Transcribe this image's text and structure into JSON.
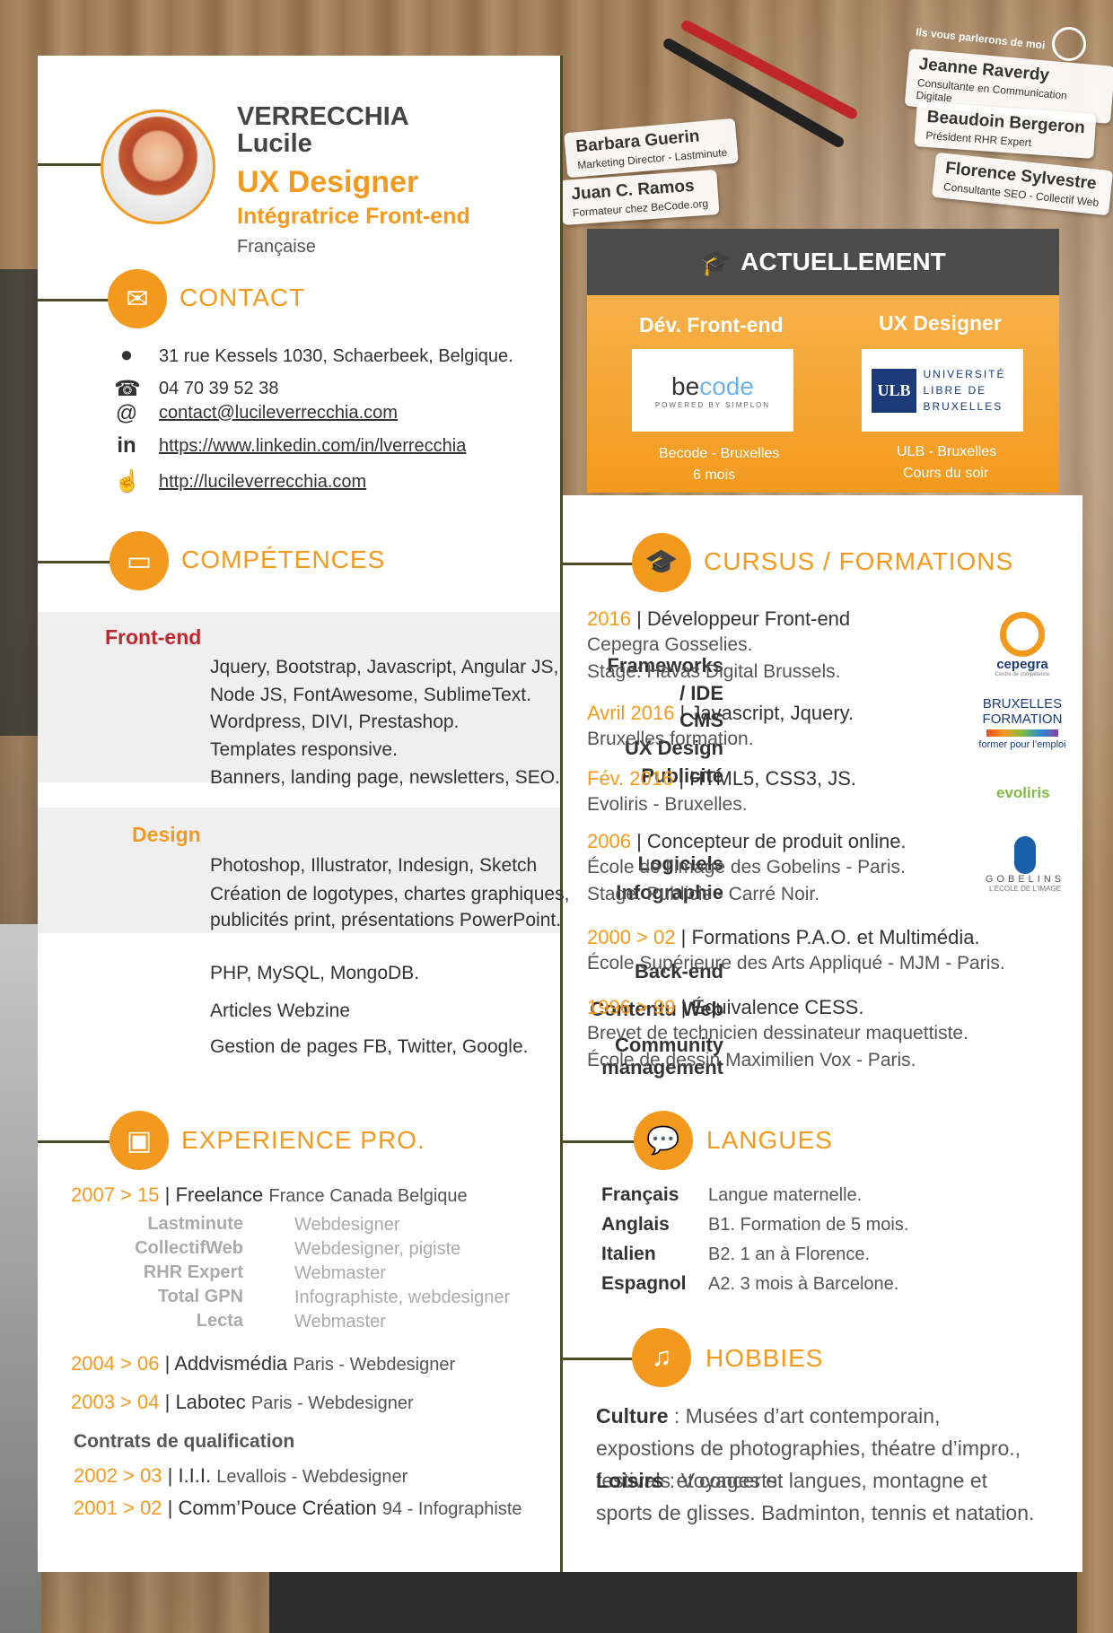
{
  "header": {
    "last_name": "VERRECCHIA",
    "first_name": "Lucile",
    "title": "UX Designer",
    "subtitle": "Intégratrice Front-end",
    "nationality": "Française"
  },
  "contact": {
    "title": "CONTACT",
    "address": "31 rue Kessels 1030, Schaerbeek, Belgique.",
    "phone": "04 70 39 52 38",
    "email": "contact@lucileverrecchia.com",
    "linkedin": "https://www.linkedin.com/in/lverrecchia",
    "website": "http://lucileverrecchia.com"
  },
  "skills": {
    "title": "COMPÉTENCES",
    "frontend": {
      "heading": "Front-end",
      "rows": [
        {
          "label": "Frameworks",
          "value": "Jquery, Bootstrap, Javascript, Angular JS,"
        },
        {
          "label": "/ IDE",
          "value": "Node JS, FontAwesome, SublimeText."
        },
        {
          "label": "CMS",
          "value": "Wordpress, DIVI, Prestashop."
        },
        {
          "label": "UX Design",
          "value": "Templates responsive."
        },
        {
          "label": "Publicité",
          "value": "Banners, landing page, newsletters, SEO."
        }
      ]
    },
    "design": {
      "heading": "Design",
      "rows": [
        {
          "label": "Logiciels",
          "value": "Photoshop, Illustrator, Indesign, Sketch"
        },
        {
          "label": "Infographie",
          "value": "Création de logotypes, chartes graphiques,"
        },
        {
          "label": "",
          "value": "publicités print, présentations PowerPoint."
        }
      ]
    },
    "other": [
      {
        "label": "Back-end",
        "value": "PHP, MySQL, MongoDB."
      },
      {
        "label": "Contentu Web",
        "value": "Articles Webzine"
      },
      {
        "label": "Community",
        "value": "Gestion de pages FB, Twitter, Google."
      },
      {
        "label": "management",
        "value": ""
      }
    ]
  },
  "experience": {
    "title": "EXPERIENCE PRO.",
    "freelance": {
      "years": "2007 > 15",
      "name": "Freelance",
      "place": "France Canada Belgique"
    },
    "clients": [
      {
        "name": "Lastminute",
        "role": "Webdesigner"
      },
      {
        "name": "CollectifWeb",
        "role": "Webdesigner, pigiste"
      },
      {
        "name": "RHR Expert",
        "role": "Webmaster"
      },
      {
        "name": "Total GPN",
        "role": "Infographiste, webdesigner"
      },
      {
        "name": "Lecta",
        "role": "Webmaster"
      }
    ],
    "jobs": [
      {
        "years": "2004 > 06",
        "name": "Addvismédia",
        "detail": "Paris - Webdesigner"
      },
      {
        "years": "2003 > 04",
        "name": "Labotec",
        "detail": "Paris - Webdesigner"
      }
    ],
    "contracts_title": "Contrats de qualification",
    "contracts": [
      {
        "years": "2002 > 03",
        "name": "I.I.I.",
        "detail": "Levallois - Webdesigner"
      },
      {
        "years": "2001 > 02",
        "name": "Comm’Pouce Création",
        "detail": "94 - Infographiste"
      }
    ]
  },
  "references": {
    "heading": "Ils vous parlerons de moi",
    "people": [
      {
        "name": "Barbara Guerin",
        "role": "Marketing Director - Lastminute"
      },
      {
        "name": "Juan C. Ramos",
        "role": "Formateur chez BeCode.org"
      },
      {
        "name": "Jeanne Raverdy",
        "role": "Consultante en Communication Digitale"
      },
      {
        "name": "Beaudoin Bergeron",
        "role": "Président RHR Expert"
      },
      {
        "name": "Florence Sylvestre",
        "role": "Consultante SEO - Collectif Web"
      }
    ]
  },
  "current": {
    "title": "ACTUELLEMENT",
    "items": [
      {
        "heading": "Dév. Front-end",
        "logo_a": "be",
        "logo_b": "code",
        "logo_sub": "POWERED BY SIMPLON",
        "line1": "Becode - Bruxelles",
        "line2": "6 mois"
      },
      {
        "heading": "UX Designer",
        "logo_a": "ULB",
        "logo_b": "UNIVERSITÉ LIBRE DE BRUXELLES",
        "logo_sub": "",
        "line1": "ULB - Bruxelles",
        "line2": "Cours du soir"
      }
    ]
  },
  "education": {
    "title": "CURSUS / FORMATIONS",
    "items": [
      {
        "year": "2016",
        "title": "Développeur Front-end",
        "lines": [
          "Cepegra Gosselies.",
          "Stage: Havas Digital Brussels."
        ]
      },
      {
        "year": "Avril 2016",
        "title": "Javascript, Jquery.",
        "lines": [
          "Bruxelles formation."
        ]
      },
      {
        "year": "Fév. 2016",
        "title": "HTML5, CSS3, JS.",
        "lines": [
          "Evoliris - Bruxelles."
        ]
      },
      {
        "year": "2006",
        "title": "Concepteur de produit online.",
        "lines": [
          "École de l’image des Gobelins - Paris.",
          "Stage: Publicis  - Carré Noir."
        ]
      },
      {
        "year": "2000 > 02",
        "title": "Formations P.A.O. et Multimédia.",
        "lines": [
          "École Supérieure des Arts Appliqué - MJM - Paris."
        ]
      },
      {
        "year": "1996 > 99",
        "title": "Équivalence CESS.",
        "lines": [
          "Brevet de technicien dessinateur maquettiste.",
          "École de dessin Maximilien Vox - Paris."
        ]
      }
    ],
    "logos": {
      "cepegra": "cepegra",
      "cepegra_sub": "Centre de compétence",
      "bxl1": "BRUXELLES",
      "bxl2": "FORMATION",
      "bxl3": "former pour l’emploi",
      "evoliris": "evoliris",
      "gobelins": "GOBELINS",
      "gobelins_sub": "L’ÉCOLE DE L’IMAGE"
    }
  },
  "languages": {
    "title": "LANGUES",
    "items": [
      {
        "name": "Français",
        "level": "Langue maternelle."
      },
      {
        "name": "Anglais",
        "level": "B1. Formation de 5 mois."
      },
      {
        "name": "Italien",
        "level": "B2. 1 an à Florence."
      },
      {
        "name": "Espagnol",
        "level": "A2. 3 mois à Barcelone."
      }
    ]
  },
  "hobbies": {
    "title": "HOBBIES",
    "culture_label": "Culture",
    "culture_text": " : Musées d’art contemporain, expostions de photographies, théatre d’impro., festivals et concerts.",
    "leisure_label": "Loisirs",
    "leisure_text": " : Voyages et langues, montagne et sports de glisses. Badminton, tennis et natation."
  },
  "colors": {
    "accent": "#f39a1e",
    "dark": "#4b4b4b",
    "red": "#c0272d"
  }
}
